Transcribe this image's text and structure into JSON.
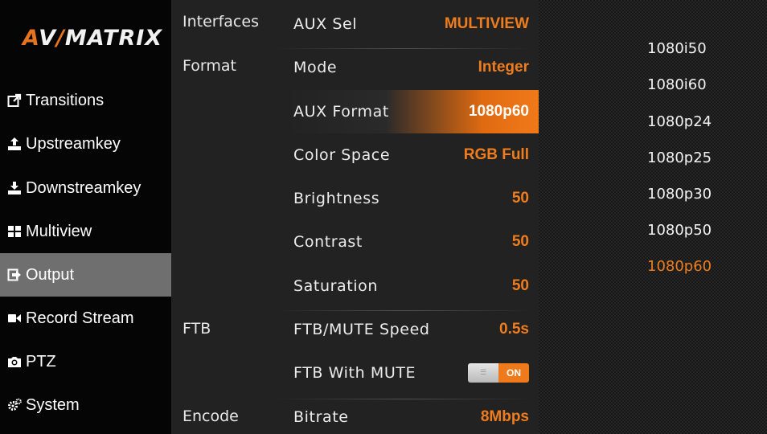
{
  "brand": {
    "logo_text": "AVMATRIX",
    "logo_accent": "#e8731d"
  },
  "sidebar": {
    "items": [
      {
        "label": "Transitions",
        "icon": "share-icon",
        "active": false
      },
      {
        "label": "Upstreamkey",
        "icon": "upload-icon",
        "active": false
      },
      {
        "label": "Downstreamkey",
        "icon": "download-icon",
        "active": false
      },
      {
        "label": "Multiview",
        "icon": "grid-icon",
        "active": false
      },
      {
        "label": "Output",
        "icon": "sign-out-icon",
        "active": true
      },
      {
        "label": "Record Stream",
        "icon": "video-camera-icon",
        "active": false
      },
      {
        "label": "PTZ",
        "icon": "camera-icon",
        "active": false
      },
      {
        "label": "System",
        "icon": "gears-icon",
        "active": false
      }
    ]
  },
  "settings": {
    "categories": {
      "interfaces": "Interfaces",
      "format": "Format",
      "ftb": "FTB",
      "encode": "Encode"
    },
    "rows": [
      {
        "label": "AUX Sel",
        "value": "MULTIVIEW"
      },
      {
        "label": "Mode",
        "value": "Integer"
      },
      {
        "label": "AUX Format",
        "value": "1080p60",
        "selected": true
      },
      {
        "label": "Color Space",
        "value": "RGB Full"
      },
      {
        "label": "Brightness",
        "value": "50"
      },
      {
        "label": "Contrast",
        "value": "50"
      },
      {
        "label": "Saturation",
        "value": "50"
      },
      {
        "label": "FTB/MUTE Speed",
        "value": "0.5s"
      },
      {
        "label": "FTB With MUTE",
        "toggle_label": "ON",
        "toggle_on": true
      },
      {
        "label": "Bitrate",
        "value": "8Mbps"
      }
    ]
  },
  "format_options": {
    "items": [
      "1080i50",
      "1080i60",
      "1080p24",
      "1080p25",
      "1080p30",
      "1080p50",
      "1080p60"
    ],
    "selected": "1080p60"
  },
  "colors": {
    "accent": "#ef7d1e",
    "active_nav": "#6f6f6f",
    "panel": "#222222",
    "sidebar": "#050505"
  }
}
